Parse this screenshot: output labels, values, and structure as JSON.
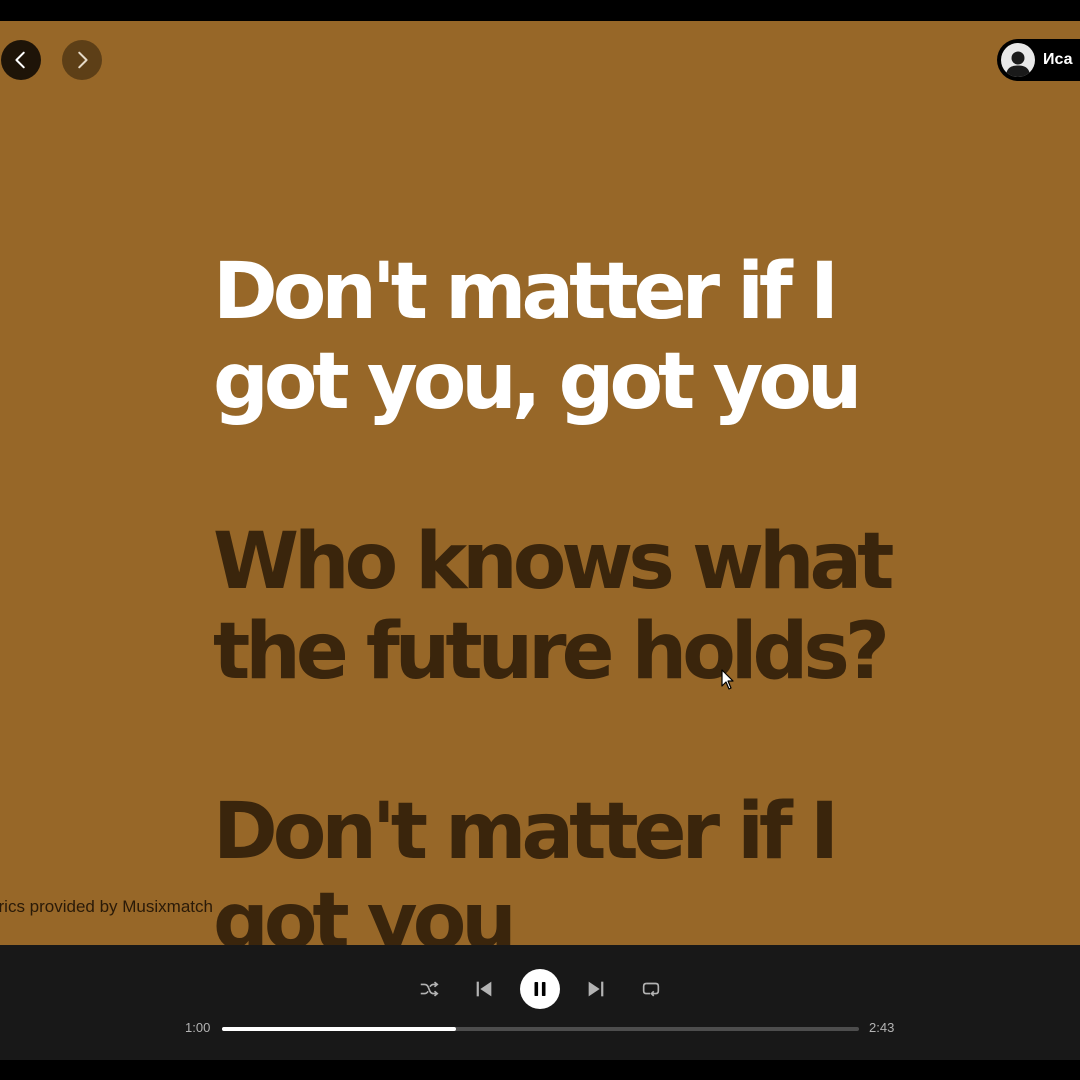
{
  "navigation": {
    "back_icon": "chevron-left-icon",
    "forward_icon": "chevron-right-icon"
  },
  "user": {
    "name": "Иса",
    "avatar_icon": "user-silhouette-icon"
  },
  "lyrics": {
    "lines": [
      {
        "text": "Don't matter if I\ngot you, got you",
        "active": true
      },
      {
        "text": "Who knows what\nthe future holds?",
        "active": false
      },
      {
        "text": "Don't matter if I\ngot you",
        "active": false
      }
    ],
    "attribution": "yrics provided by Musixmatch"
  },
  "player": {
    "elapsed": "1:00",
    "total": "2:43",
    "progress_fraction": 0.368,
    "icons": {
      "shuffle": "shuffle-icon",
      "previous": "skip-previous-icon",
      "play_pause": "pause-icon",
      "next": "skip-next-icon",
      "repeat": "repeat-icon"
    }
  },
  "colors": {
    "background": "#976728",
    "active_lyric": "#ffffff",
    "inactive_lyric": "#3a250c",
    "player_bar": "#181818"
  }
}
